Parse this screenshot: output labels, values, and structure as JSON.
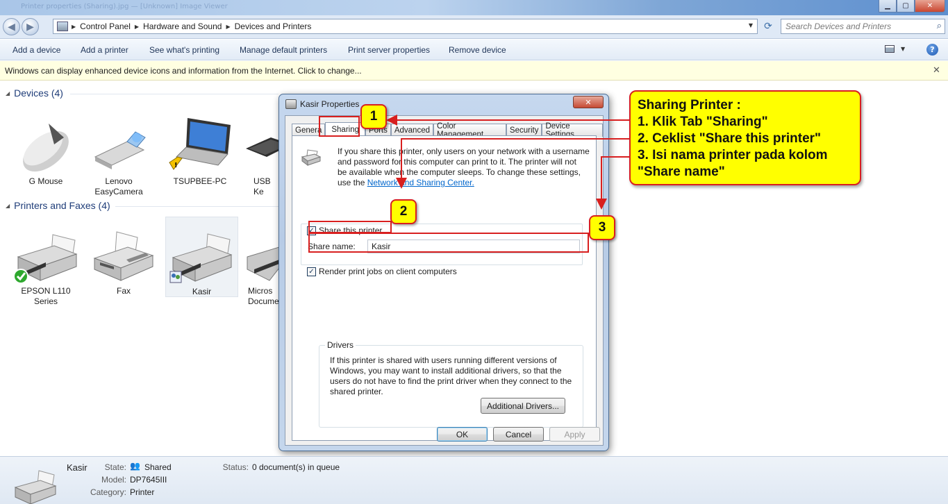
{
  "window": {
    "title_ghost": "Printer properties (Sharing).jpg — [Unknown] Image Viewer",
    "minimize": "▁",
    "maximize": "▢",
    "close": "✕"
  },
  "address": {
    "crumbs": [
      "Control Panel",
      "Hardware and Sound",
      "Devices and Printers"
    ],
    "search_placeholder": "Search Devices and Printers"
  },
  "toolbar": {
    "items": [
      "Add a device",
      "Add a printer",
      "See what's printing",
      "Manage default printers",
      "Print server properties",
      "Remove device"
    ]
  },
  "infobar": {
    "text": "Windows can display enhanced device icons and information from the Internet. Click to change...",
    "close": "✕"
  },
  "devices": {
    "header": "Devices (4)",
    "items": [
      {
        "line1": "G Mouse",
        "line2": ""
      },
      {
        "line1": "Lenovo",
        "line2": "EasyCamera"
      },
      {
        "line1": "TSUPBEE-PC",
        "line2": ""
      },
      {
        "line1": "USB Ke",
        "line2": ""
      }
    ]
  },
  "printers": {
    "header": "Printers and Faxes (4)",
    "items": [
      {
        "line1": "EPSON L110",
        "line2": "Series"
      },
      {
        "line1": "Fax",
        "line2": ""
      },
      {
        "line1": "Kasir",
        "line2": ""
      },
      {
        "line1": "Micros",
        "line2": "Docume"
      }
    ]
  },
  "dialog": {
    "title": "Kasir Properties",
    "close": "✕",
    "tabs": [
      "Genera",
      "Sharing",
      "Ports",
      "Advanced",
      "Color Management",
      "Security",
      "Device Settings"
    ],
    "intro_lines": [
      "If you share this printer, only users on your network with a username",
      "and password for this computer can print to it. The printer will not",
      "be available when the computer sleeps. To change these settings,"
    ],
    "intro_prefix": "use the ",
    "intro_link": "Network and Sharing Center.",
    "share_checkbox": "Share this printer",
    "share_name_label": "Share name:",
    "share_name_value": "Kasir",
    "render_checkbox": "Render print jobs on client computers",
    "drivers_legend": "Drivers",
    "drivers_lines": [
      "If this printer is shared with users running different versions of",
      "Windows, you may want to install additional drivers, so that the",
      "users do not have to find the print driver when they connect to the",
      "shared printer."
    ],
    "additional_drivers": "Additional Drivers...",
    "ok": "OK",
    "cancel": "Cancel",
    "apply": "Apply"
  },
  "annotations": {
    "badges": [
      "1",
      "2",
      "3"
    ],
    "callout_lines": [
      "Sharing Printer :",
      "1. Klik Tab \"Sharing\"",
      "2. Ceklist \"Share this printer\"",
      "3. Isi nama printer pada kolom",
      "\"Share name\""
    ],
    "color_yellow": "#ffff00",
    "color_red": "#d81f1f"
  },
  "details": {
    "name": "Kasir",
    "state_label": "State:",
    "state_value": "Shared",
    "model_label": "Model:",
    "model_value": "DP7645III",
    "category_label": "Category:",
    "category_value": "Printer",
    "status_label": "Status:",
    "status_value": "0 document(s) in queue"
  }
}
